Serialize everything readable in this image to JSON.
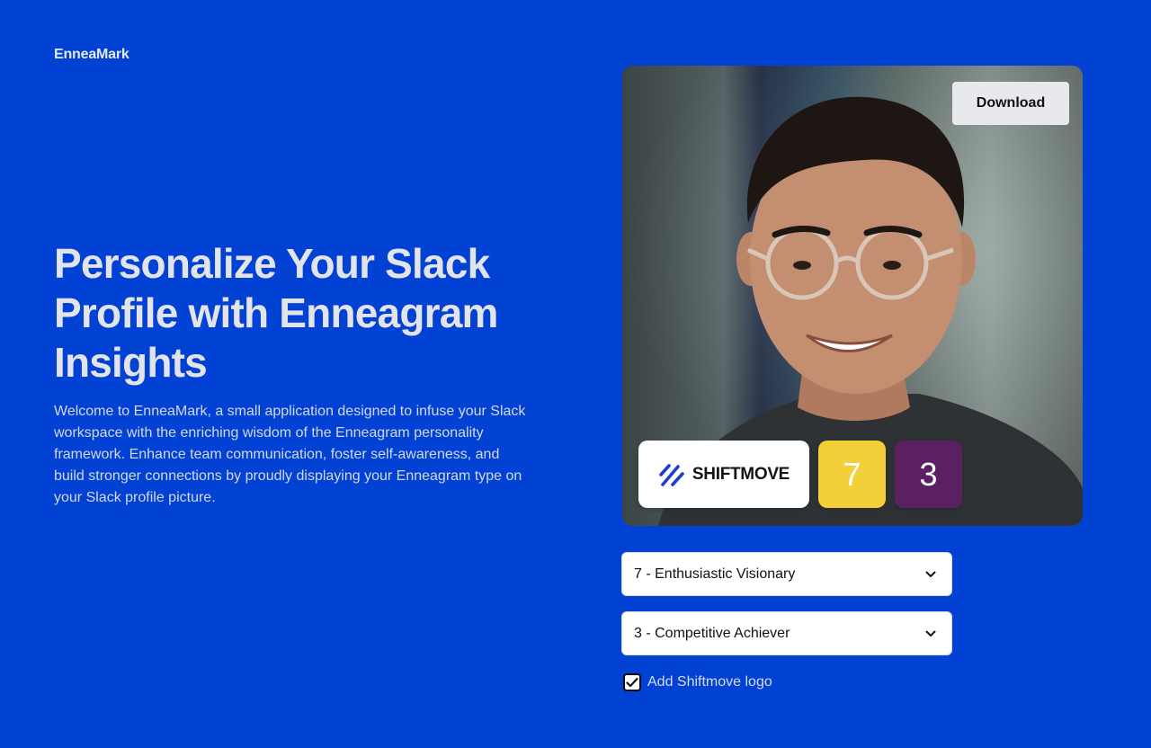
{
  "app": {
    "logo": "EnneaMark"
  },
  "hero": {
    "title": "Personalize Your Slack Profile with Enneagram Insights",
    "description": "Welcome to EnneaMark, a small application designed to infuse your Slack workspace with the enriching wisdom of the Enneagram personality framework. Enhance team communication, foster self-awareness, and build stronger connections by proudly displaying your Enneagram type on your Slack profile picture."
  },
  "preview": {
    "download_label": "Download",
    "logo_badge_text": "SHIFTMOVE",
    "badges": [
      {
        "value": "7",
        "color": "#f3d03a"
      },
      {
        "value": "3",
        "color": "#5b2062"
      }
    ]
  },
  "controls": {
    "primary_select": "7 - Enthusiastic Visionary",
    "secondary_select": "3 - Competitive Achiever",
    "checkbox_label": "Add Shiftmove logo",
    "checkbox_checked": true
  },
  "colors": {
    "background": "#0141d3",
    "accent_blue": "#1a3fd1"
  }
}
